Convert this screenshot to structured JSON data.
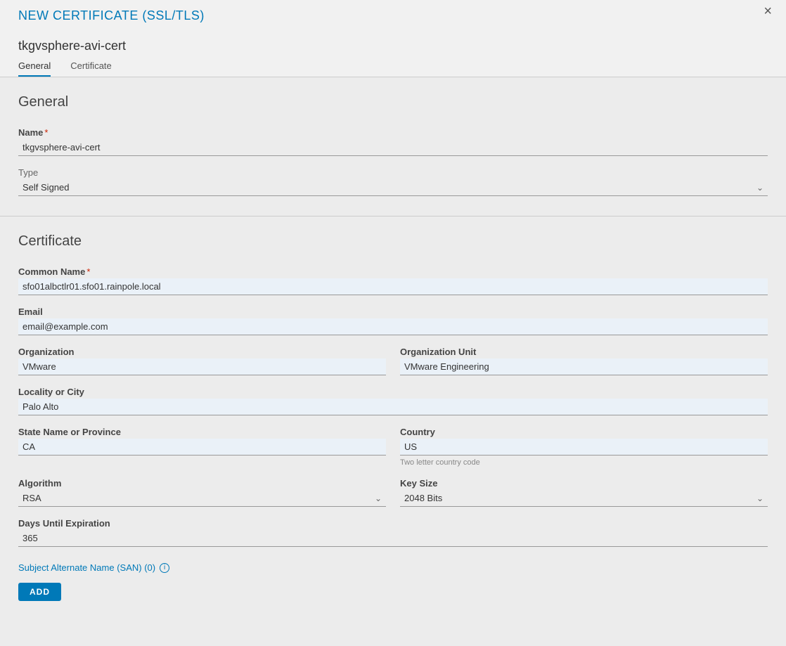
{
  "header": {
    "title": "NEW CERTIFICATE (SSL/TLS)",
    "subtitle": "tkgvsphere-avi-cert"
  },
  "tabs": {
    "general": "General",
    "certificate": "Certificate"
  },
  "general": {
    "section_title": "General",
    "name_label": "Name",
    "name_value": "tkgvsphere-avi-cert",
    "type_label": "Type",
    "type_value": "Self Signed"
  },
  "certificate": {
    "section_title": "Certificate",
    "common_name_label": "Common Name",
    "common_name_value": "sfo01albctlr01.sfo01.rainpole.local",
    "email_label": "Email",
    "email_value": "email@example.com",
    "org_label": "Organization",
    "org_value": "VMware",
    "org_unit_label": "Organization Unit",
    "org_unit_value": "VMware Engineering",
    "locality_label": "Locality or City",
    "locality_value": "Palo Alto",
    "state_label": "State Name or Province",
    "state_value": "CA",
    "country_label": "Country",
    "country_value": "US",
    "country_helper": "Two letter country code",
    "algorithm_label": "Algorithm",
    "algorithm_value": "RSA",
    "keysize_label": "Key Size",
    "keysize_value": "2048 Bits",
    "days_label": "Days Until Expiration",
    "days_value": "365",
    "san_label": "Subject Alternate Name (SAN) (0)",
    "add_button": "ADD"
  }
}
